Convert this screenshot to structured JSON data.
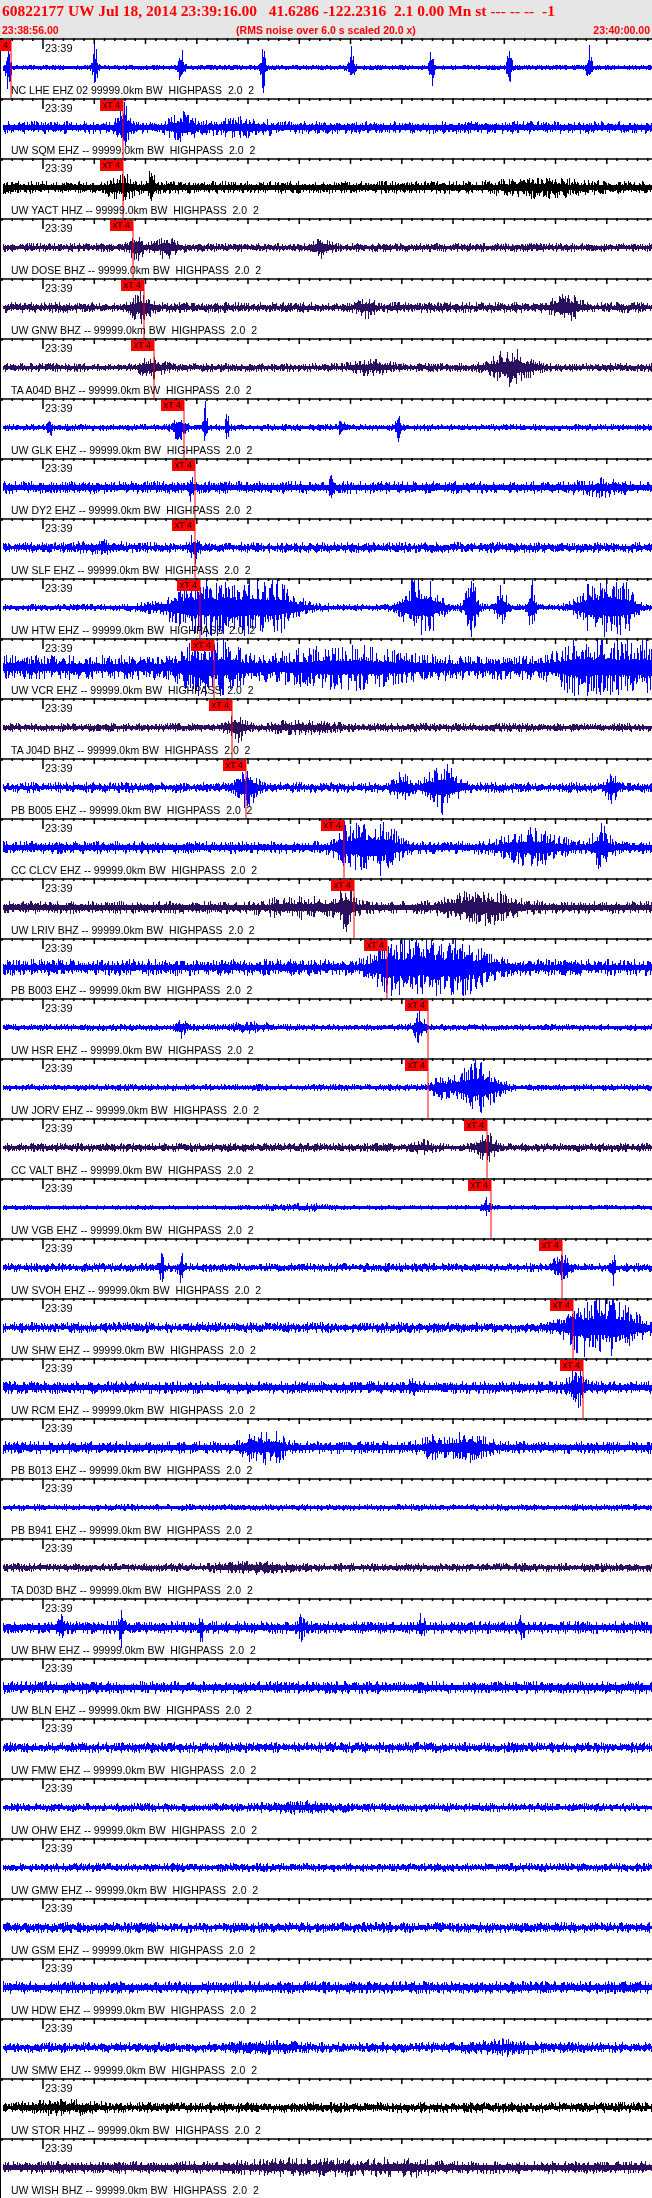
{
  "header": {
    "title": "60822177 UW Jul 18, 2014 23:39:16.00   41.6286 -122.2316  2.1 0.00 Mn st --- -- --  -1",
    "start_time": "23:38:56.00",
    "note": "(RMS noise over 6.0 s scaled 20.0 x)",
    "end_time": "23:40:00.00"
  },
  "traces": [
    {
      "station": "NC LHE EHZ 02 99999.0km BW  HIGHPASS  2.0  2",
      "time_label": "23:39",
      "color": "#0000ff",
      "pick": {
        "label": "4"
      }
    },
    {
      "station": "UW SQM EHZ -- 99999.0km BW  HIGHPASS  2.0  2",
      "time_label": "23:39",
      "color": "#0000ff",
      "pick": {
        "label": "xT 4"
      }
    },
    {
      "station": "UW YACT HHZ -- 99999.0km BW  HIGHPASS  2.0  2",
      "time_label": "23:39",
      "color": "#000000",
      "pick": {
        "label": "xT 4"
      }
    },
    {
      "station": "UW DOSE BHZ -- 99999.0km BW  HIGHPASS  2.0  2",
      "time_label": "23:39",
      "color": "#2b1060",
      "pick": {
        "label": "xT 4"
      }
    },
    {
      "station": "UW GNW BHZ -- 99999.0km BW  HIGHPASS  2.0  2",
      "time_label": "23:39",
      "color": "#2b1060",
      "pick": {
        "label": "xT 4"
      }
    },
    {
      "station": "TA A04D BHZ -- 99999.0km BW  HIGHPASS  2.0  2",
      "time_label": "23:39",
      "color": "#2b1060",
      "pick": {
        "label": "xT 4"
      }
    },
    {
      "station": "UW GLK EHZ -- 99999.0km BW  HIGHPASS  2.0  2",
      "time_label": "23:39",
      "color": "#0000ff",
      "pick": {
        "label": "xT 4"
      }
    },
    {
      "station": "UW DY2 EHZ -- 99999.0km BW  HIGHPASS  2.0  2",
      "time_label": "23:39",
      "color": "#0000ff",
      "pick": {
        "label": "xT 4"
      }
    },
    {
      "station": "UW SLF EHZ -- 99999.0km BW  HIGHPASS  2.0  2",
      "time_label": "23:39",
      "color": "#0000ff",
      "pick": {
        "label": "xT 4"
      }
    },
    {
      "station": "UW HTW EHZ -- 99999.0km BW  HIGHPASS  2.0  2",
      "time_label": "23:39",
      "color": "#0000ff",
      "pick": {
        "label": "xT 4"
      }
    },
    {
      "station": "UW VCR EHZ -- 99999.0km BW  HIGHPASS  2.0  2",
      "time_label": "23:39",
      "color": "#0000ff",
      "pick": {
        "label": "xT 4"
      }
    },
    {
      "station": "TA J04D BHZ -- 99999.0km BW  HIGHPASS  2.0  2",
      "time_label": "23:39",
      "color": "#2b1060",
      "pick": {
        "label": "xT 4"
      }
    },
    {
      "station": "PB B005 EHZ -- 99999.0km BW  HIGHPASS  2.0  2",
      "time_label": "23:39",
      "color": "#0000ff",
      "pick": {
        "label": "xT 4"
      }
    },
    {
      "station": "CC CLCV EHZ -- 99999.0km BW  HIGHPASS  2.0  2",
      "time_label": "23:39",
      "color": "#0000ff",
      "pick": {
        "label": "xT 4"
      }
    },
    {
      "station": "UW LRIV BHZ -- 99999.0km BW  HIGHPASS  2.0  2",
      "time_label": "23:39",
      "color": "#2b1060",
      "pick": {
        "label": "xT 4"
      }
    },
    {
      "station": "PB B003 EHZ -- 99999.0km BW  HIGHPASS  2.0  2",
      "time_label": "23:39",
      "color": "#0000ff",
      "pick": {
        "label": "xT 4"
      }
    },
    {
      "station": "UW HSR EHZ -- 99999.0km BW  HIGHPASS  2.0  2",
      "time_label": "23:39",
      "color": "#0000ff",
      "pick": {
        "label": "xT 4"
      }
    },
    {
      "station": "UW JORV EHZ -- 99999.0km BW  HIGHPASS  2.0  2",
      "time_label": "23:39",
      "color": "#0000ff",
      "pick": {
        "label": "xT 4"
      }
    },
    {
      "station": "CC VALT BHZ -- 99999.0km BW  HIGHPASS  2.0  2",
      "time_label": "23:39",
      "color": "#2b1060",
      "pick": {
        "label": "xT 4"
      }
    },
    {
      "station": "UW VGB EHZ -- 99999.0km BW  HIGHPASS  2.0  2",
      "time_label": "23:39",
      "color": "#0000ff",
      "pick": {
        "label": "xT 4"
      }
    },
    {
      "station": "UW SVOH EHZ -- 99999.0km BW  HIGHPASS  2.0  2",
      "time_label": "23:39",
      "color": "#0000ff",
      "pick": {
        "label": "xT 4"
      }
    },
    {
      "station": "UW SHW EHZ -- 99999.0km BW  HIGHPASS  2.0  2",
      "time_label": "23:39",
      "color": "#0000ff",
      "pick": {
        "label": "xT 4"
      }
    },
    {
      "station": "UW RCM EHZ -- 99999.0km BW  HIGHPASS  2.0  2",
      "time_label": "23:39",
      "color": "#0000ff",
      "pick": {
        "label": "xT 4"
      }
    },
    {
      "station": "PB B013 EHZ -- 99999.0km BW  HIGHPASS  2.0  2",
      "time_label": "23:39",
      "color": "#0000ff"
    },
    {
      "station": "PB B941 EHZ -- 99999.0km BW  HIGHPASS  2.0  2",
      "time_label": "23:39",
      "color": "#0000ff"
    },
    {
      "station": "TA D03D BHZ -- 99999.0km BW  HIGHPASS  2.0  2",
      "time_label": "23:39",
      "color": "#2b1060"
    },
    {
      "station": "UW BHW EHZ -- 99999.0km BW  HIGHPASS  2.0  2",
      "time_label": "23:39",
      "color": "#0000ff"
    },
    {
      "station": "UW BLN EHZ -- 99999.0km BW  HIGHPASS  2.0  2",
      "time_label": "23:39",
      "color": "#0000ff"
    },
    {
      "station": "UW FMW EHZ -- 99999.0km BW  HIGHPASS  2.0  2",
      "time_label": "23:39",
      "color": "#0000ff"
    },
    {
      "station": "UW OHW EHZ -- 99999.0km BW  HIGHPASS  2.0  2",
      "time_label": "23:39",
      "color": "#0000ff"
    },
    {
      "station": "UW GMW EHZ -- 99999.0km BW  HIGHPASS  2.0  2",
      "time_label": "23:39",
      "color": "#0000ff"
    },
    {
      "station": "UW GSM EHZ -- 99999.0km BW  HIGHPASS  2.0  2",
      "time_label": "23:39",
      "color": "#0000ff"
    },
    {
      "station": "UW HDW EHZ -- 99999.0km BW  HIGHPASS  2.0  2",
      "time_label": "23:39",
      "color": "#0000ff"
    },
    {
      "station": "UW SMW EHZ -- 99999.0km BW  HIGHPASS  2.0  2",
      "time_label": "23:39",
      "color": "#0000ff"
    },
    {
      "station": "UW STOR HHZ -- 99999.0km BW  HIGHPASS  2.0  2",
      "time_label": "23:39",
      "color": "#000000"
    },
    {
      "station": "UW WISH BHZ -- 99999.0km BW  HIGHPASS  2.0  2",
      "time_label": "23:39",
      "color": "#2b1060"
    }
  ]
}
